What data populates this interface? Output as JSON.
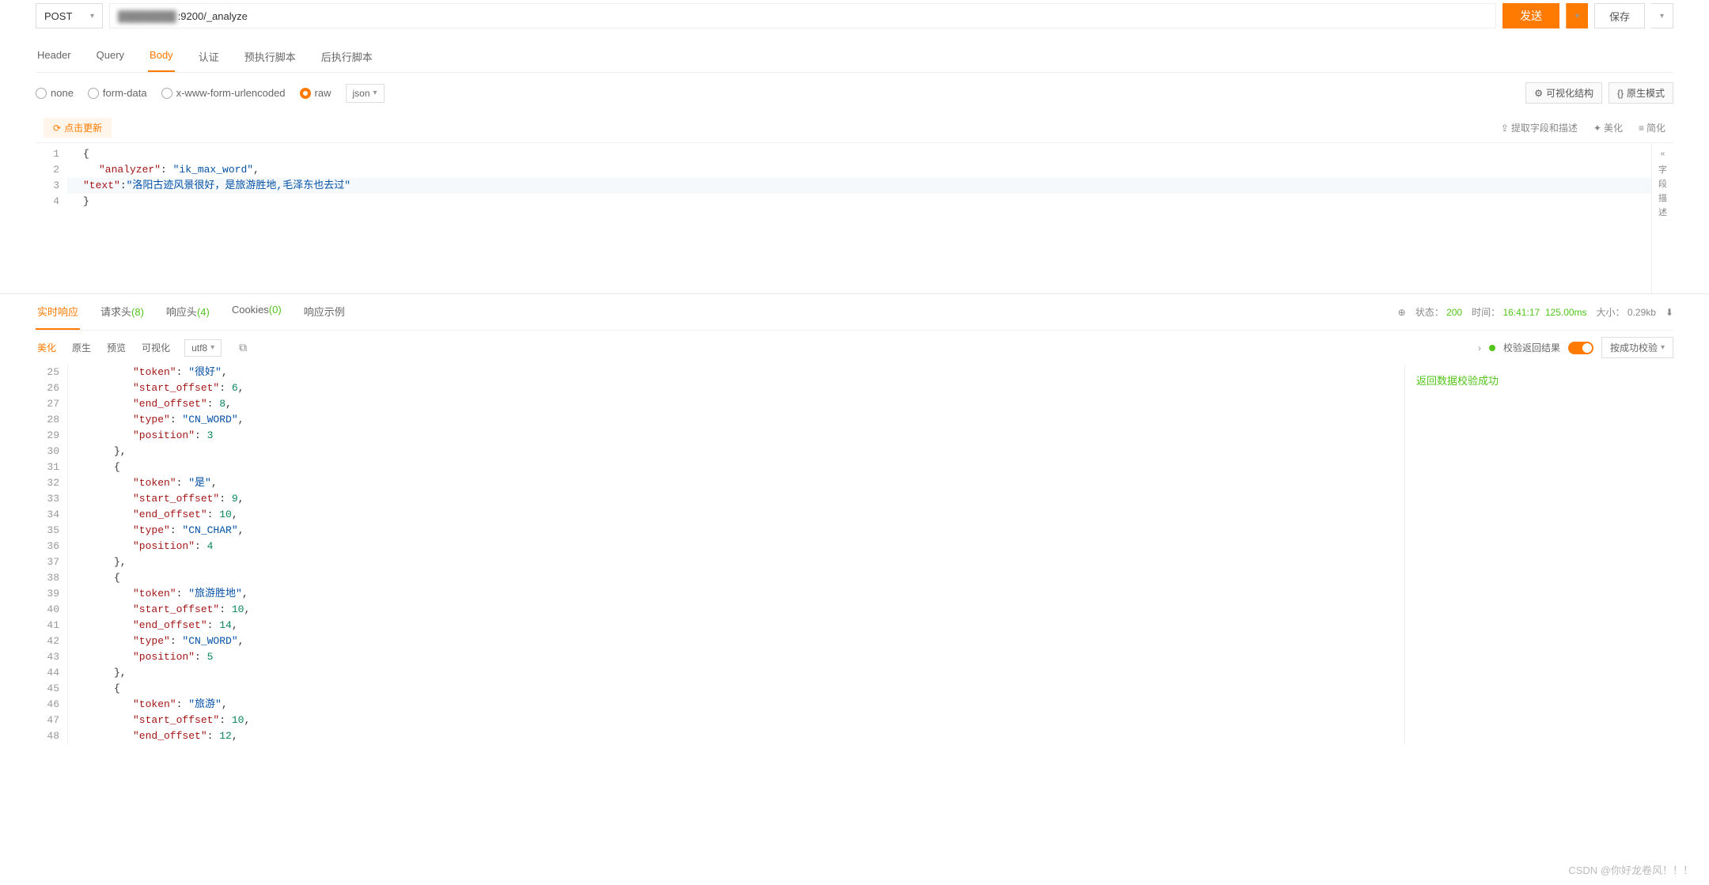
{
  "request": {
    "method": "POST",
    "url_suffix": ":9200/_analyze",
    "send": "发送",
    "save": "保存"
  },
  "req_tabs": {
    "header": "Header",
    "query": "Query",
    "body": "Body",
    "auth": "认证",
    "pre": "预执行脚本",
    "post": "后执行脚本"
  },
  "body_types": {
    "none": "none",
    "form": "form-data",
    "url": "x-www-form-urlencoded",
    "raw": "raw",
    "json": "json"
  },
  "view_buttons": {
    "visual": "可视化结构",
    "native": "原生模式"
  },
  "update_btn": "点击更新",
  "tools": {
    "extract": "提取字段和描述",
    "beautify": "美化",
    "simplify": "简化"
  },
  "side": {
    "label": "字段描述"
  },
  "request_body": {
    "l1": "{",
    "l2_k": "\"analyzer\"",
    "l2_v": "\"ik_max_word\"",
    "l3_k": "\"text\"",
    "l3_v": "\"洛阳古迹风景很好，是旅游胜地,毛泽东也去过\"",
    "l4": "}"
  },
  "resp_tabs": {
    "realtime": "实时响应",
    "reqh": "请求头",
    "reqh_n": "(8)",
    "resph": "响应头",
    "resph_n": "(4)",
    "cookies": "Cookies",
    "cookies_n": "(0)",
    "example": "响应示例"
  },
  "status": {
    "label": "状态：",
    "code": "200",
    "time_label": "时间：",
    "time": "16:41:17",
    "duration": "125.00ms",
    "size_label": "大小：",
    "size": "0.29kb"
  },
  "resp_views": {
    "beautify": "美化",
    "raw": "原生",
    "preview": "预览",
    "visual": "可视化",
    "encoding": "utf8"
  },
  "validation": {
    "title": "校验返回结果",
    "selector": "按成功校验",
    "message": "返回数据校验成功"
  },
  "response_lines": [
    {
      "n": 25,
      "ind": 3,
      "parts": [
        {
          "t": "k",
          "v": "\"token\""
        },
        {
          "t": "p",
          "v": ": "
        },
        {
          "t": "s",
          "v": "\"很好\""
        },
        {
          "t": "p",
          "v": ","
        }
      ]
    },
    {
      "n": 26,
      "ind": 3,
      "parts": [
        {
          "t": "k",
          "v": "\"start_offset\""
        },
        {
          "t": "p",
          "v": ": "
        },
        {
          "t": "n",
          "v": "6"
        },
        {
          "t": "p",
          "v": ","
        }
      ]
    },
    {
      "n": 27,
      "ind": 3,
      "parts": [
        {
          "t": "k",
          "v": "\"end_offset\""
        },
        {
          "t": "p",
          "v": ": "
        },
        {
          "t": "n",
          "v": "8"
        },
        {
          "t": "p",
          "v": ","
        }
      ]
    },
    {
      "n": 28,
      "ind": 3,
      "parts": [
        {
          "t": "k",
          "v": "\"type\""
        },
        {
          "t": "p",
          "v": ": "
        },
        {
          "t": "s",
          "v": "\"CN_WORD\""
        },
        {
          "t": "p",
          "v": ","
        }
      ]
    },
    {
      "n": 29,
      "ind": 3,
      "parts": [
        {
          "t": "k",
          "v": "\"position\""
        },
        {
          "t": "p",
          "v": ": "
        },
        {
          "t": "n",
          "v": "3"
        }
      ]
    },
    {
      "n": 30,
      "ind": 2,
      "parts": [
        {
          "t": "p",
          "v": "},"
        }
      ]
    },
    {
      "n": 31,
      "ind": 2,
      "parts": [
        {
          "t": "p",
          "v": "{"
        }
      ]
    },
    {
      "n": 32,
      "ind": 3,
      "parts": [
        {
          "t": "k",
          "v": "\"token\""
        },
        {
          "t": "p",
          "v": ": "
        },
        {
          "t": "s",
          "v": "\"是\""
        },
        {
          "t": "p",
          "v": ","
        }
      ]
    },
    {
      "n": 33,
      "ind": 3,
      "parts": [
        {
          "t": "k",
          "v": "\"start_offset\""
        },
        {
          "t": "p",
          "v": ": "
        },
        {
          "t": "n",
          "v": "9"
        },
        {
          "t": "p",
          "v": ","
        }
      ]
    },
    {
      "n": 34,
      "ind": 3,
      "parts": [
        {
          "t": "k",
          "v": "\"end_offset\""
        },
        {
          "t": "p",
          "v": ": "
        },
        {
          "t": "n",
          "v": "10"
        },
        {
          "t": "p",
          "v": ","
        }
      ]
    },
    {
      "n": 35,
      "ind": 3,
      "parts": [
        {
          "t": "k",
          "v": "\"type\""
        },
        {
          "t": "p",
          "v": ": "
        },
        {
          "t": "s",
          "v": "\"CN_CHAR\""
        },
        {
          "t": "p",
          "v": ","
        }
      ]
    },
    {
      "n": 36,
      "ind": 3,
      "parts": [
        {
          "t": "k",
          "v": "\"position\""
        },
        {
          "t": "p",
          "v": ": "
        },
        {
          "t": "n",
          "v": "4"
        }
      ]
    },
    {
      "n": 37,
      "ind": 2,
      "parts": [
        {
          "t": "p",
          "v": "},"
        }
      ]
    },
    {
      "n": 38,
      "ind": 2,
      "parts": [
        {
          "t": "p",
          "v": "{"
        }
      ]
    },
    {
      "n": 39,
      "ind": 3,
      "parts": [
        {
          "t": "k",
          "v": "\"token\""
        },
        {
          "t": "p",
          "v": ": "
        },
        {
          "t": "s",
          "v": "\"旅游胜地\""
        },
        {
          "t": "p",
          "v": ","
        }
      ]
    },
    {
      "n": 40,
      "ind": 3,
      "parts": [
        {
          "t": "k",
          "v": "\"start_offset\""
        },
        {
          "t": "p",
          "v": ": "
        },
        {
          "t": "n",
          "v": "10"
        },
        {
          "t": "p",
          "v": ","
        }
      ]
    },
    {
      "n": 41,
      "ind": 3,
      "parts": [
        {
          "t": "k",
          "v": "\"end_offset\""
        },
        {
          "t": "p",
          "v": ": "
        },
        {
          "t": "n",
          "v": "14"
        },
        {
          "t": "p",
          "v": ","
        }
      ]
    },
    {
      "n": 42,
      "ind": 3,
      "parts": [
        {
          "t": "k",
          "v": "\"type\""
        },
        {
          "t": "p",
          "v": ": "
        },
        {
          "t": "s",
          "v": "\"CN_WORD\""
        },
        {
          "t": "p",
          "v": ","
        }
      ]
    },
    {
      "n": 43,
      "ind": 3,
      "parts": [
        {
          "t": "k",
          "v": "\"position\""
        },
        {
          "t": "p",
          "v": ": "
        },
        {
          "t": "n",
          "v": "5"
        }
      ]
    },
    {
      "n": 44,
      "ind": 2,
      "parts": [
        {
          "t": "p",
          "v": "},"
        }
      ]
    },
    {
      "n": 45,
      "ind": 2,
      "parts": [
        {
          "t": "p",
          "v": "{"
        }
      ]
    },
    {
      "n": 46,
      "ind": 3,
      "parts": [
        {
          "t": "k",
          "v": "\"token\""
        },
        {
          "t": "p",
          "v": ": "
        },
        {
          "t": "s",
          "v": "\"旅游\""
        },
        {
          "t": "p",
          "v": ","
        }
      ]
    },
    {
      "n": 47,
      "ind": 3,
      "parts": [
        {
          "t": "k",
          "v": "\"start_offset\""
        },
        {
          "t": "p",
          "v": ": "
        },
        {
          "t": "n",
          "v": "10"
        },
        {
          "t": "p",
          "v": ","
        }
      ]
    },
    {
      "n": 48,
      "ind": 3,
      "parts": [
        {
          "t": "k",
          "v": "\"end_offset\""
        },
        {
          "t": "p",
          "v": ": "
        },
        {
          "t": "n",
          "v": "12"
        },
        {
          "t": "p",
          "v": ","
        }
      ]
    }
  ],
  "watermark": "CSDN @你好龙卷风！！！"
}
